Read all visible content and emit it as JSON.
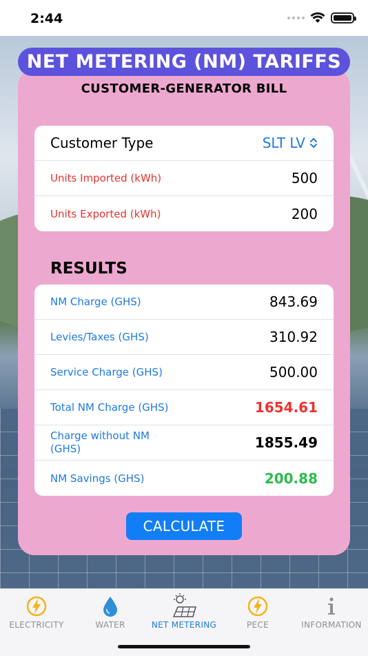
{
  "status_bar": {
    "time": "2:44"
  },
  "header": {
    "title": "NET METERING (NM) TARIFFS",
    "subtitle": "CUSTOMER-GENERATOR BILL"
  },
  "inputs": {
    "customer_type_label": "Customer Type",
    "customer_type_value": "SLT LV",
    "units_imported_label": "Units Imported (kWh)",
    "units_imported_value": "500",
    "units_exported_label": "Units Exported (kWh)",
    "units_exported_value": "200"
  },
  "results": {
    "heading": "RESULTS",
    "rows": [
      {
        "label": "NM Charge (GHS)",
        "value": "843.69"
      },
      {
        "label": "Levies/Taxes (GHS)",
        "value": "310.92"
      },
      {
        "label": "Service Charge (GHS)",
        "value": "500.00"
      },
      {
        "label": "Total NM Charge (GHS)",
        "value": "1654.61"
      },
      {
        "label": "Charge without NM (GHS)",
        "value": "1855.49"
      },
      {
        "label": "NM Savings (GHS)",
        "value": "200.88"
      }
    ]
  },
  "calculate_label": "CALCULATE",
  "tabs": [
    {
      "label": "ELECTRICITY",
      "icon": "lightning-icon"
    },
    {
      "label": "WATER",
      "icon": "water-drop-icon"
    },
    {
      "label": "NET METERING",
      "icon": "solar-panel-icon",
      "active": true
    },
    {
      "label": "PECE",
      "icon": "lightning-icon"
    },
    {
      "label": "INFORMATION",
      "icon": "info-icon"
    }
  ],
  "colors": {
    "accent": "#1f7ae0",
    "title_pill": "#5d52dc",
    "card": "#eda8d0",
    "total_red": "#ee3030",
    "savings_green": "#2dba4e",
    "button": "#117ef6"
  }
}
